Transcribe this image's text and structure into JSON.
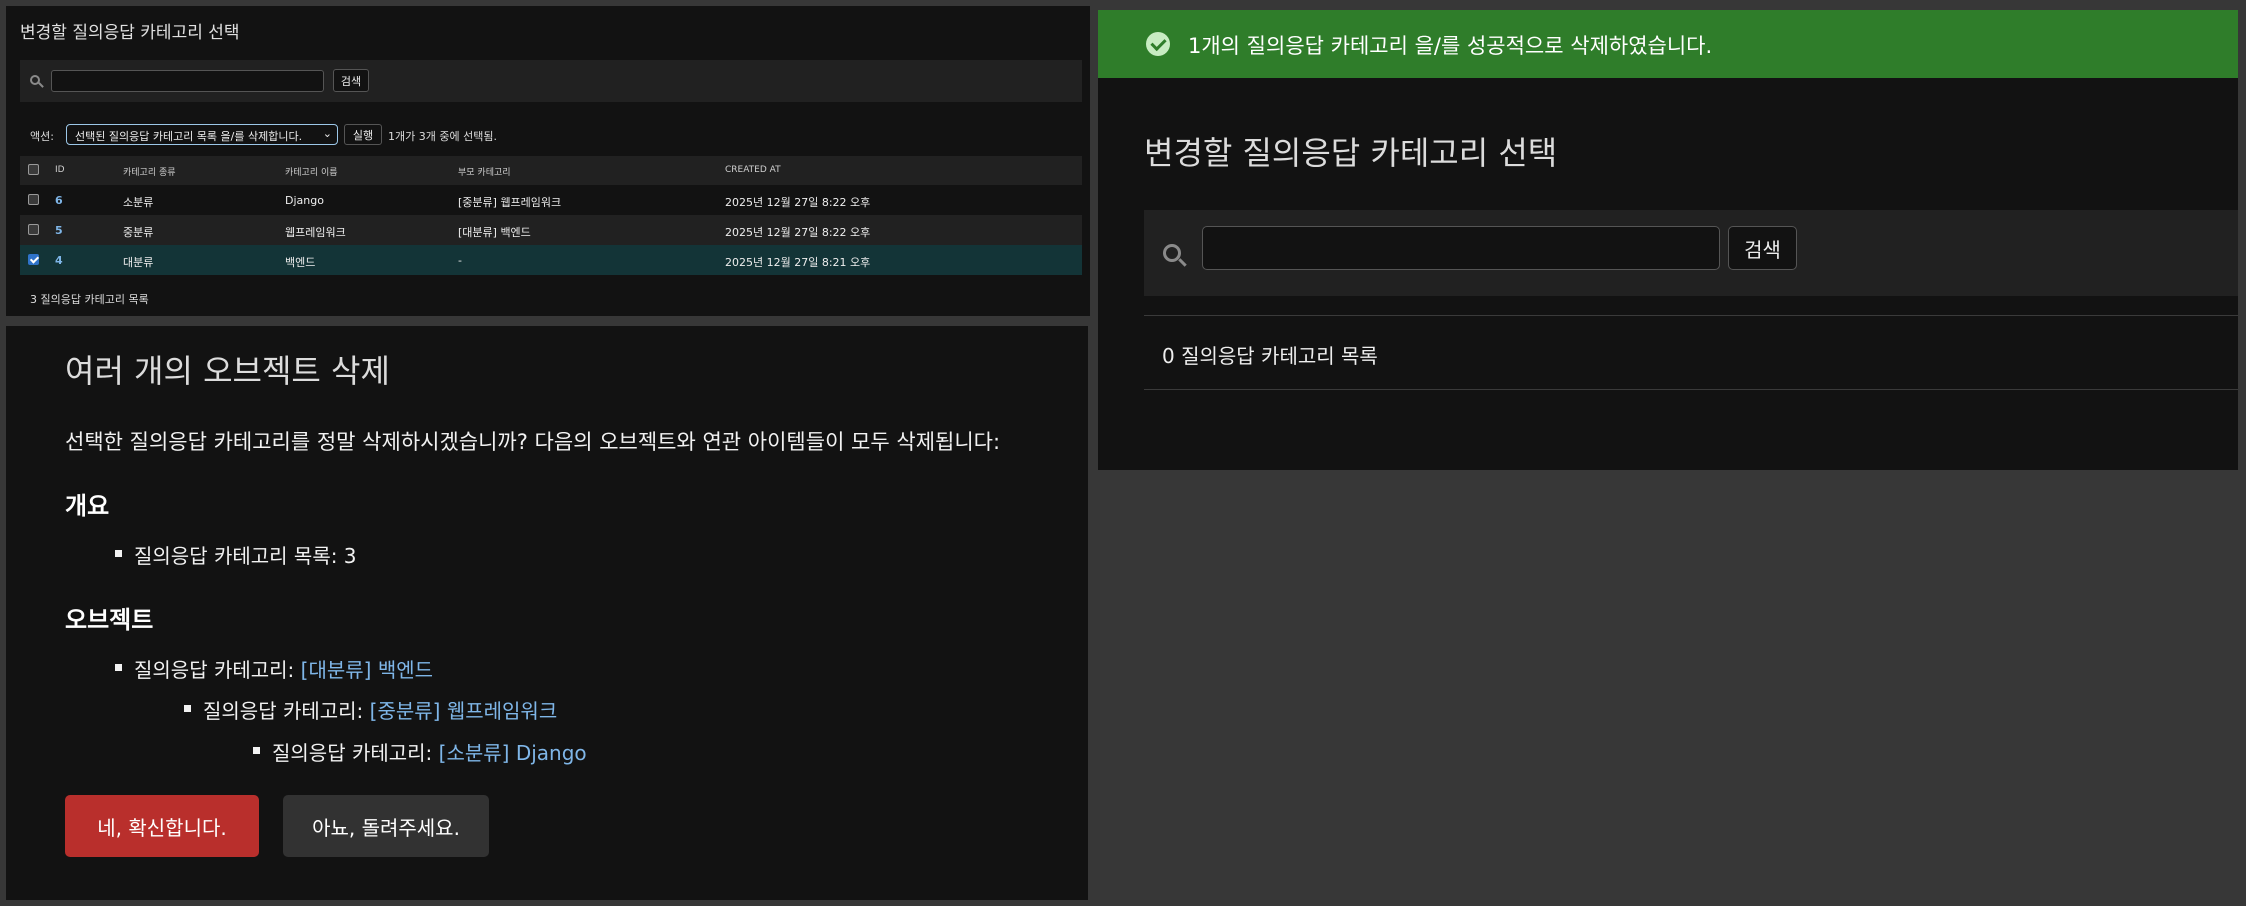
{
  "changelist": {
    "title": "변경할 질의응답 카테고리 선택",
    "search": {
      "value": "",
      "button_label": "검색"
    },
    "actions": {
      "label": "액션:",
      "selected_option": "선택된 질의응답 카테고리 목록 을/를 삭제합니다.",
      "go_label": "실행",
      "counter": "1개가 3개 중에 선택됨."
    },
    "columns": [
      "ID",
      "카테고리 종류",
      "카테고리 이름",
      "부모 카테고리",
      "CREATED AT"
    ],
    "rows": [
      {
        "id": "6",
        "type": "소분류",
        "name": "Django",
        "parent": "[중분류] 웹프레임워크",
        "created": "2025년 12월 27일 8:22 오후",
        "checked": false
      },
      {
        "id": "5",
        "type": "중분류",
        "name": "웹프레임워크",
        "parent": "[대분류] 백엔드",
        "created": "2025년 12월 27일 8:22 오후",
        "checked": false
      },
      {
        "id": "4",
        "type": "대분류",
        "name": "백엔드",
        "parent": "-",
        "created": "2025년 12월 27일 8:21 오후",
        "checked": true
      }
    ],
    "footer": "3 질의응답 카테고리 목록"
  },
  "delete_confirmation": {
    "title": "여러 개의 오브젝트 삭제",
    "question": "선택한 질의응답 카테고리를 정말 삭제하시겠습니까? 다음의 오브젝트와 연관 아이템들이 모두 삭제됩니다:",
    "summary_heading": "개요",
    "summary_item": "질의응답 카테고리 목록: 3",
    "objects_heading": "오브젝트",
    "objects": [
      {
        "prefix": "질의응답 카테고리:",
        "link": "[대분류] 백엔드"
      },
      {
        "prefix": "질의응답 카테고리:",
        "link": "[중분류] 웹프레임워크"
      },
      {
        "prefix": "질의응답 카테고리:",
        "link": "[소분류] Django"
      }
    ],
    "confirm_label": "네, 확신합니다.",
    "cancel_label": "아뇨, 돌려주세요."
  },
  "result": {
    "message": "1개의 질의응답 카테고리 을/를 성공적으로 삭제하였습니다.",
    "title": "변경할 질의응답 카테고리 선택",
    "search_button_label": "검색",
    "count": "0 질의응답 카테고리 목록"
  },
  "colors": {
    "success": "#2f7d2a",
    "danger": "#b92f2c",
    "link": "#7fb6e8",
    "selected_row": "#133437"
  }
}
